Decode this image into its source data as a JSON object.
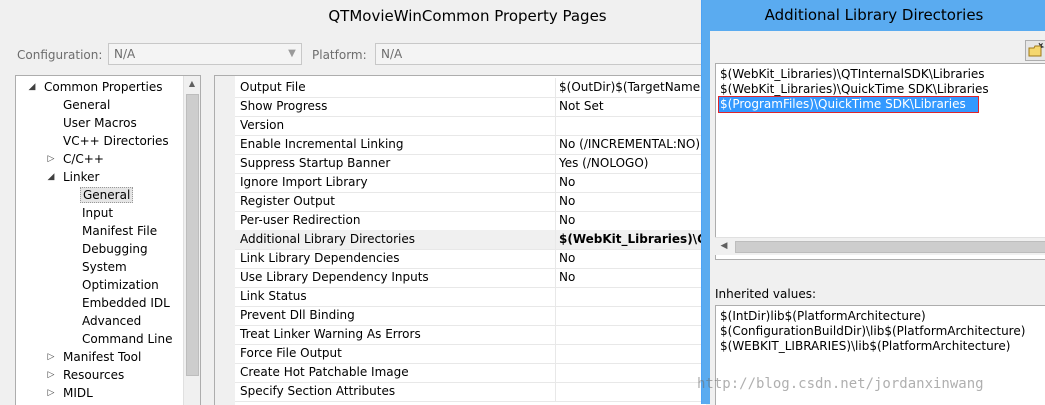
{
  "window": {
    "title": "QTMovieWinCommon Property Pages"
  },
  "toolbar": {
    "configuration_label": "Configuration:",
    "configuration_value": "N/A",
    "platform_label": "Platform:",
    "platform_value": "N/A"
  },
  "tree": {
    "items": [
      {
        "label": "Common Properties",
        "level": 0,
        "expander": "expanded"
      },
      {
        "label": "General",
        "level": 1,
        "expander": "none"
      },
      {
        "label": "User Macros",
        "level": 1,
        "expander": "none"
      },
      {
        "label": "VC++ Directories",
        "level": 1,
        "expander": "none"
      },
      {
        "label": "C/C++",
        "level": 1,
        "expander": "collapsed"
      },
      {
        "label": "Linker",
        "level": 1,
        "expander": "expanded"
      },
      {
        "label": "General",
        "level": 2,
        "expander": "none",
        "selected": true
      },
      {
        "label": "Input",
        "level": 2,
        "expander": "none"
      },
      {
        "label": "Manifest File",
        "level": 2,
        "expander": "none"
      },
      {
        "label": "Debugging",
        "level": 2,
        "expander": "none"
      },
      {
        "label": "System",
        "level": 2,
        "expander": "none"
      },
      {
        "label": "Optimization",
        "level": 2,
        "expander": "none"
      },
      {
        "label": "Embedded IDL",
        "level": 2,
        "expander": "none"
      },
      {
        "label": "Advanced",
        "level": 2,
        "expander": "none"
      },
      {
        "label": "Command Line",
        "level": 2,
        "expander": "none"
      },
      {
        "label": "Manifest Tool",
        "level": 1,
        "expander": "collapsed"
      },
      {
        "label": "Resources",
        "level": 1,
        "expander": "collapsed"
      },
      {
        "label": "MIDL",
        "level": 1,
        "expander": "collapsed"
      }
    ]
  },
  "grid": {
    "rows": [
      {
        "name": "Output File",
        "value": "$(OutDir)$(TargetName)$"
      },
      {
        "name": "Show Progress",
        "value": "Not Set"
      },
      {
        "name": "Version",
        "value": ""
      },
      {
        "name": "Enable Incremental Linking",
        "value": "No (/INCREMENTAL:NO)"
      },
      {
        "name": "Suppress Startup Banner",
        "value": "Yes (/NOLOGO)"
      },
      {
        "name": "Ignore Import Library",
        "value": "No"
      },
      {
        "name": "Register Output",
        "value": "No"
      },
      {
        "name": "Per-user Redirection",
        "value": "No"
      },
      {
        "name": "Additional Library Directories",
        "value": "$(WebKit_Libraries)\\QT",
        "highlight": true,
        "bold": true
      },
      {
        "name": "Link Library Dependencies",
        "value": "No"
      },
      {
        "name": "Use Library Dependency Inputs",
        "value": "No"
      },
      {
        "name": "Link Status",
        "value": ""
      },
      {
        "name": "Prevent Dll Binding",
        "value": ""
      },
      {
        "name": "Treat Linker Warning As Errors",
        "value": ""
      },
      {
        "name": "Force File Output",
        "value": ""
      },
      {
        "name": "Create Hot Patchable Image",
        "value": ""
      },
      {
        "name": "Specify Section Attributes",
        "value": ""
      }
    ]
  },
  "dialog": {
    "title": "Additional Library Directories",
    "directories": [
      "$(WebKit_Libraries)\\QTInternalSDK\\Libraries",
      "$(WebKit_Libraries)\\QuickTime SDK\\Libraries",
      "$(ProgramFiles)\\QuickTime SDK\\Libraries"
    ],
    "selected_index": 2,
    "inherited_label": "Inherited values:",
    "inherited_values": [
      "$(IntDir)lib$(PlatformArchitecture)",
      "$(ConfigurationBuildDir)\\lib$(PlatformArchitecture)",
      "$(WEBKIT_LIBRARIES)\\lib$(PlatformArchitecture)"
    ]
  },
  "watermark": "http://blog.csdn.net/jordanxinwang",
  "colors": {
    "dialog_frame": "#5aabf0",
    "selection": "#3399ff",
    "selection_outline": "#e0242b"
  }
}
